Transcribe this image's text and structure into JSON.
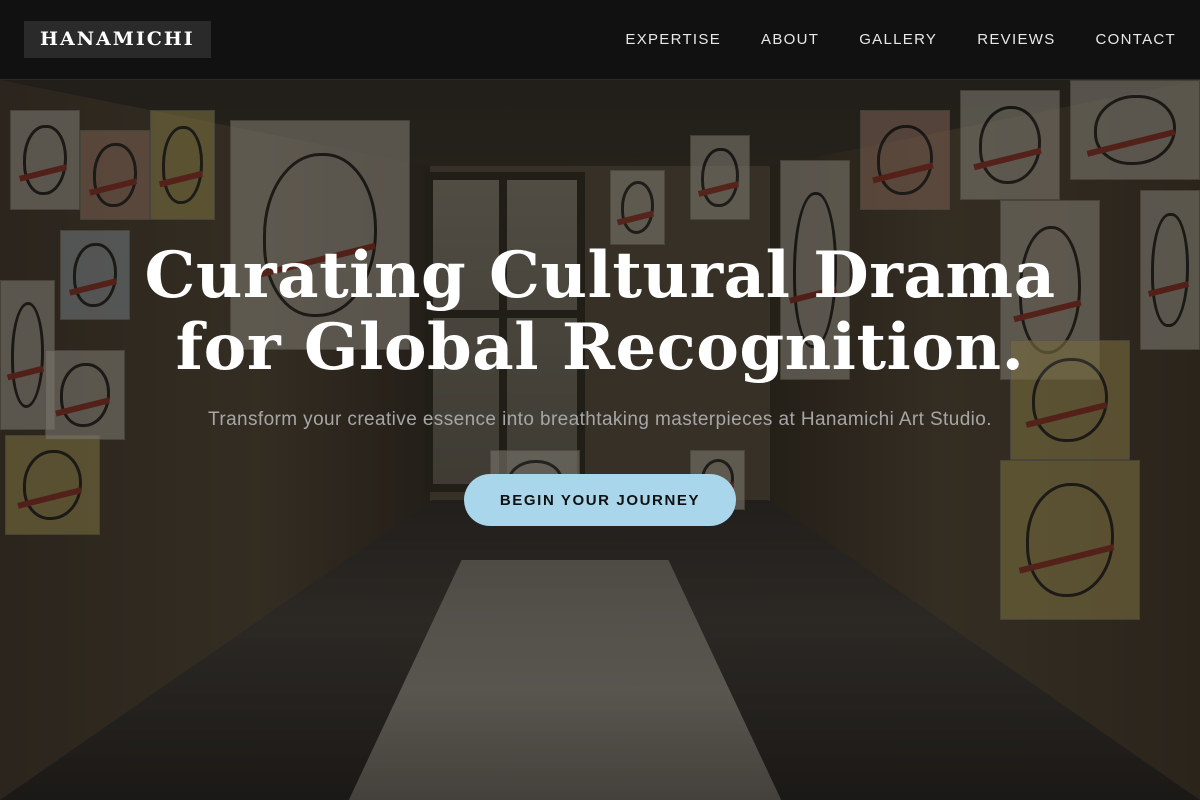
{
  "brand": {
    "name": "HANAMICHI"
  },
  "nav": {
    "items": [
      {
        "label": "EXPERTISE"
      },
      {
        "label": "ABOUT"
      },
      {
        "label": "GALLERY"
      },
      {
        "label": "REVIEWS"
      },
      {
        "label": "CONTACT"
      }
    ]
  },
  "hero": {
    "title_line_1": "Curating Cultural Drama",
    "title_line_2": "for Global Recognition.",
    "subtitle": "Transform your creative essence into breathtaking masterpieces at Hanamichi Art Studio.",
    "cta_label": "BEGIN YOUR JOURNEY"
  },
  "colors": {
    "navbar_bg": "#111111",
    "brand_bg": "#2a2a2a",
    "cta_bg": "#a9d6ea",
    "title_text": "#ffffff",
    "subtitle_text": "#a6a6a6"
  }
}
